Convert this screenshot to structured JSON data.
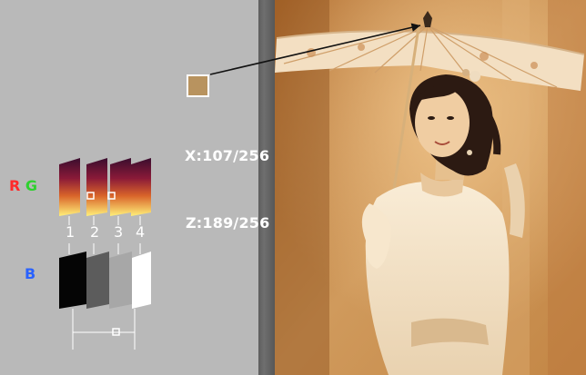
{
  "sample": {
    "color": "#b8935f"
  },
  "readout": {
    "x": "X:107/256",
    "z": "Z:189/256"
  },
  "labels": {
    "r": "R",
    "g": "G",
    "b": "B"
  },
  "colors": {
    "r": "#ff2a2a",
    "g": "#2fd12f",
    "b": "#2a62ff",
    "photo_tint": "#c7894a"
  },
  "gradient_numbers": [
    "1",
    "2",
    "3",
    "4"
  ]
}
